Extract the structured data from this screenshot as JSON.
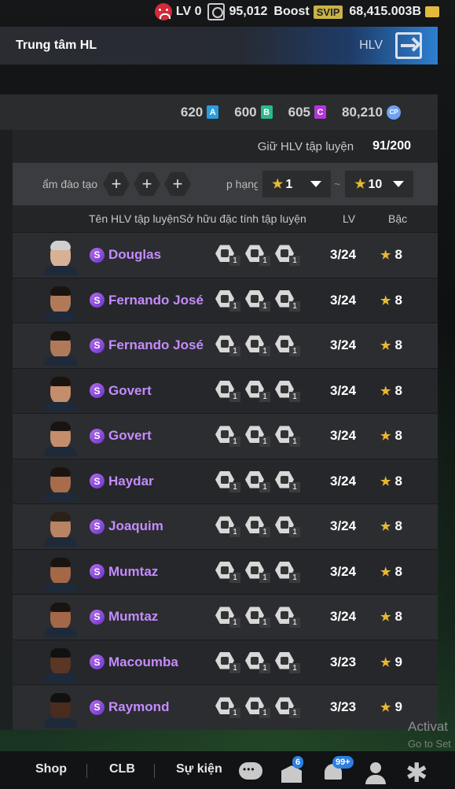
{
  "topbar": {
    "level": "LV 0",
    "points": "95,012",
    "boost": "Boost",
    "svip": "SVIP",
    "coins": "68,415.003B"
  },
  "header": {
    "title": "Trung tâm HL",
    "right_label": "HLV"
  },
  "currency": {
    "a_value": "620",
    "a_badge": "A",
    "b_value": "600",
    "b_badge": "B",
    "c_value": "605",
    "c_badge": "C",
    "cp_value": "80,210",
    "cp_badge": "CP"
  },
  "keep": {
    "label": "Giữ HLV tập luyện",
    "value": "91/200"
  },
  "filter": {
    "training_label": "ẩm đào tạo",
    "plus": "+",
    "rank_label": "p hạng",
    "min_rank": "1",
    "max_rank": "10",
    "tilde": "~"
  },
  "columns": {
    "name": "Tên HLV tập luyện",
    "traits": "Sở hữu đặc tính tập luyện",
    "lv": "LV",
    "rank": "Bậc"
  },
  "coaches": [
    {
      "name": "Douglas",
      "lv": "3/24",
      "rank": "8",
      "badge": "S",
      "trait_count": "1",
      "skin": "#d8b096",
      "hair": "#cfcfcf"
    },
    {
      "name": "Fernando José",
      "lv": "3/24",
      "rank": "8",
      "badge": "S",
      "trait_count": "1",
      "skin": "#b07a5a",
      "hair": "#1a1410"
    },
    {
      "name": "Fernando José",
      "lv": "3/24",
      "rank": "8",
      "badge": "S",
      "trait_count": "1",
      "skin": "#b07a5a",
      "hair": "#1a1410"
    },
    {
      "name": "Govert",
      "lv": "3/24",
      "rank": "8",
      "badge": "S",
      "trait_count": "1",
      "skin": "#c48e6c",
      "hair": "#1a1410"
    },
    {
      "name": "Govert",
      "lv": "3/24",
      "rank": "8",
      "badge": "S",
      "trait_count": "1",
      "skin": "#c48e6c",
      "hair": "#1a1410"
    },
    {
      "name": "Haydar",
      "lv": "3/24",
      "rank": "8",
      "badge": "S",
      "trait_count": "1",
      "skin": "#a86c4c",
      "hair": "#1a1410"
    },
    {
      "name": "Joaquim",
      "lv": "3/24",
      "rank": "8",
      "badge": "S",
      "trait_count": "1",
      "skin": "#b98464",
      "hair": "#2a2018"
    },
    {
      "name": "Mumtaz",
      "lv": "3/24",
      "rank": "8",
      "badge": "S",
      "trait_count": "1",
      "skin": "#a46848",
      "hair": "#1a1410"
    },
    {
      "name": "Mumtaz",
      "lv": "3/24",
      "rank": "8",
      "badge": "S",
      "trait_count": "1",
      "skin": "#a46848",
      "hair": "#1a1410"
    },
    {
      "name": "Macoumba",
      "lv": "3/23",
      "rank": "9",
      "badge": "S",
      "trait_count": "1",
      "skin": "#5a3624",
      "hair": "#111"
    },
    {
      "name": "Raymond",
      "lv": "3/23",
      "rank": "9",
      "badge": "S",
      "trait_count": "1",
      "skin": "#4a2c1e",
      "hair": "#111"
    }
  ],
  "watermark": {
    "line1": "Activat",
    "line2": "Go to Set"
  },
  "nav": {
    "shop": "Shop",
    "clb": "CLB",
    "events": "Sự kiện",
    "flag_badge": "6",
    "bell_badge": "99+"
  },
  "colors": {
    "accent_purple": "#c58bff",
    "star_gold": "#e8b830",
    "header_blue": "#2d7fd1"
  }
}
